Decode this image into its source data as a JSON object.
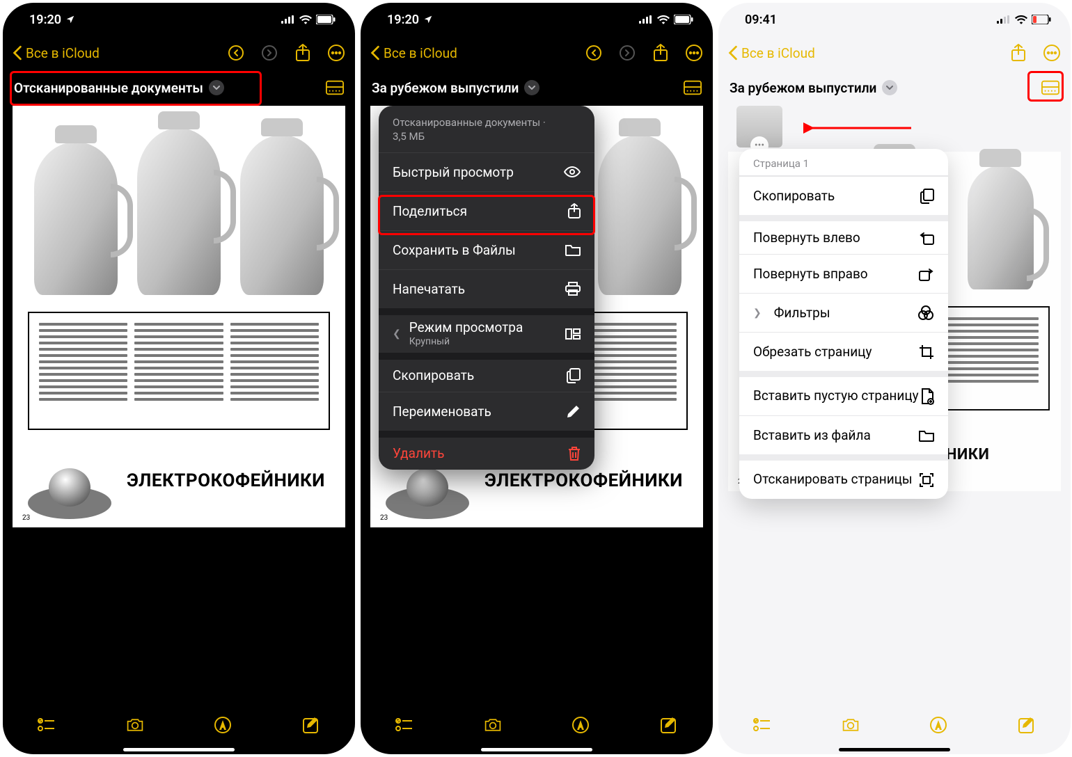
{
  "colors": {
    "accent": "#e6b800",
    "red": "#ff0000",
    "destructive": "#ff453a"
  },
  "common": {
    "back_label": "Все в iCloud",
    "brand": "ЭЛЕКТРОКОФЕЙНИКИ",
    "page_num": "23"
  },
  "screens": [
    {
      "statusbar": {
        "time": "19:20",
        "location_icon": true
      },
      "title": "Отсканированные документы",
      "highlight": "title"
    },
    {
      "statusbar": {
        "time": "19:20",
        "location_icon": true
      },
      "title": "За рубежом выпустили",
      "sheet": {
        "header_line1": "Отсканированные документы ·",
        "header_line2": "3,5 МБ",
        "rows": [
          {
            "label": "Быстрый просмотр",
            "icon": "eye"
          },
          {
            "label": "Поделиться",
            "icon": "share"
          },
          {
            "label": "Сохранить в Файлы",
            "icon": "folder",
            "highlighted": true
          },
          {
            "label": "Напечатать",
            "icon": "print"
          },
          {
            "label": "Режим просмотра",
            "sublabel": "Крупный",
            "icon": "grid",
            "has_chevron": true,
            "group_gap": true
          },
          {
            "label": "Скопировать",
            "icon": "copy",
            "group_gap": true
          },
          {
            "label": "Переименовать",
            "icon": "pencil"
          },
          {
            "label": "Удалить",
            "icon": "trash",
            "destructive": true,
            "group_gap": true
          }
        ]
      }
    },
    {
      "statusbar": {
        "time": "09:41",
        "location_icon": false,
        "low_battery": true
      },
      "title": "За рубежом выпустили",
      "highlight": "scantray",
      "light": true,
      "page_menu": {
        "header": "Страница 1",
        "rows": [
          {
            "label": "Скопировать",
            "icon": "copy"
          },
          {
            "label": "Повернуть влево",
            "icon": "rotate-left",
            "group_gap": true
          },
          {
            "label": "Повернуть вправо",
            "icon": "rotate-right"
          },
          {
            "label": "Фильтры",
            "icon": "filters",
            "has_chevron": true
          },
          {
            "label": "Обрезать страницу",
            "icon": "crop"
          },
          {
            "label": "Вставить пустую страницу",
            "icon": "page-plus",
            "group_gap": true,
            "tall": true
          },
          {
            "label": "Вставить из файла",
            "icon": "folder"
          },
          {
            "label": "Отсканировать страницы",
            "icon": "scan",
            "group_gap": true,
            "tall": true
          }
        ]
      }
    }
  ]
}
